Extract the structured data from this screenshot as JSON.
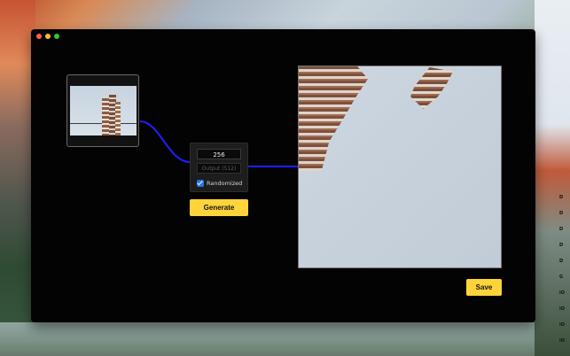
{
  "window": {
    "controls": [
      "close",
      "minimize",
      "maximize"
    ]
  },
  "input_node": {
    "image_description": "Input image thumbnail (building)"
  },
  "controls": {
    "size_value": "256",
    "output_placeholder": "Output (512)",
    "randomized_label": "Randomized",
    "randomized_checked": true
  },
  "buttons": {
    "generate_label": "Generate",
    "save_label": "Save"
  },
  "colors": {
    "accent_button": "#ffd43b",
    "wire": "#1f1fff",
    "window_bg": "#030303",
    "checkbox": "#2a72e8"
  },
  "desktop": {
    "labels": [
      "D",
      "D",
      "D",
      "D",
      "D",
      "G",
      "iO",
      "iO",
      "iO",
      "iO"
    ]
  }
}
